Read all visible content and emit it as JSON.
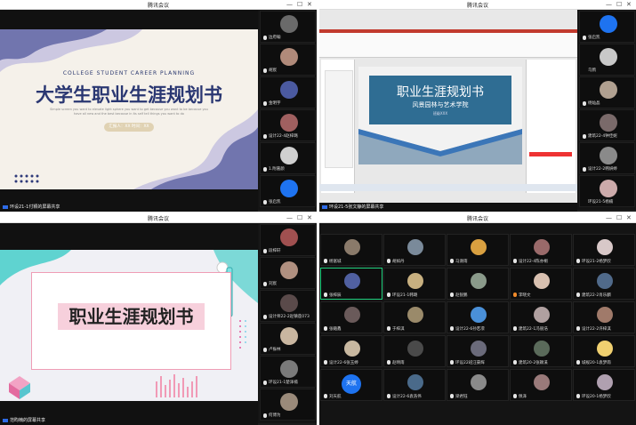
{
  "app_title": "腾讯会议",
  "window_controls": [
    "—",
    "☐",
    "✕"
  ],
  "windows": [
    {
      "share_label": "环设21-1付颖的屏幕共享",
      "slide": {
        "english_title": "COLLEGE STUDENT CAREER PLANNING",
        "chinese_title": "大学生职业生涯规划书",
        "body": "Simple screen you want to elevate light sphere you want to get because you want to be because you have all new and the best because in its self tell things you want to do",
        "pill": "汇报人：XX 时间：XX"
      },
      "participants": [
        "边府翰",
        "胡宸",
        "金明宇",
        "设计22-4赵梓璐",
        "1.附嘉颜",
        "张启凯"
      ]
    },
    {
      "share_label": "环设21-5张文静的屏幕共享",
      "slide": {
        "title": "职业生涯规划书",
        "subtitle": "风景园林与艺术学院",
        "meta": "班级XXX"
      },
      "participants": [
        "张启凯",
        "乌鸦",
        "杨灿晶",
        "建筑22-4钟佳妮",
        "设计22-2韩妍婷",
        "环设21-5杨楠"
      ]
    },
    {
      "share_label": "范昀楠的屏幕共享",
      "slide": {
        "title": "职业生涯规划书"
      },
      "participants": [
        "段梓轩",
        "刘宸",
        "设计师22-2赵镇莲073",
        "卢振林",
        "环设21-1楚泽楠",
        "何博为"
      ]
    },
    {
      "rows": [
        [
          "杨富城",
          "胡如丹",
          "马濒雨",
          "设计22-4陈亦桐",
          "环设21-2杨梦欣"
        ],
        [
          "张梓辰",
          "环设21-1韩璐",
          "赵锐鹏",
          "李晓文",
          "建筑22-2肖乐麟"
        ],
        [
          "张籍鑫",
          "于梓淇",
          "设计22-6孙若凛",
          "建筑22-1冯丽浩",
          "设计22-2许梓淇"
        ],
        [
          "设计22-6张玉婷",
          "赵晴雨",
          "环设22班汪豪辉",
          "建筑20-2张颖溪",
          "城规20-1袁梦雨"
        ],
        [
          "刘天航",
          "设计22-6袁浩伟",
          "梁君钰",
          "佩泽",
          "环设20-1杨梦欣"
        ]
      ],
      "tianhang_avatar": "天航"
    }
  ]
}
